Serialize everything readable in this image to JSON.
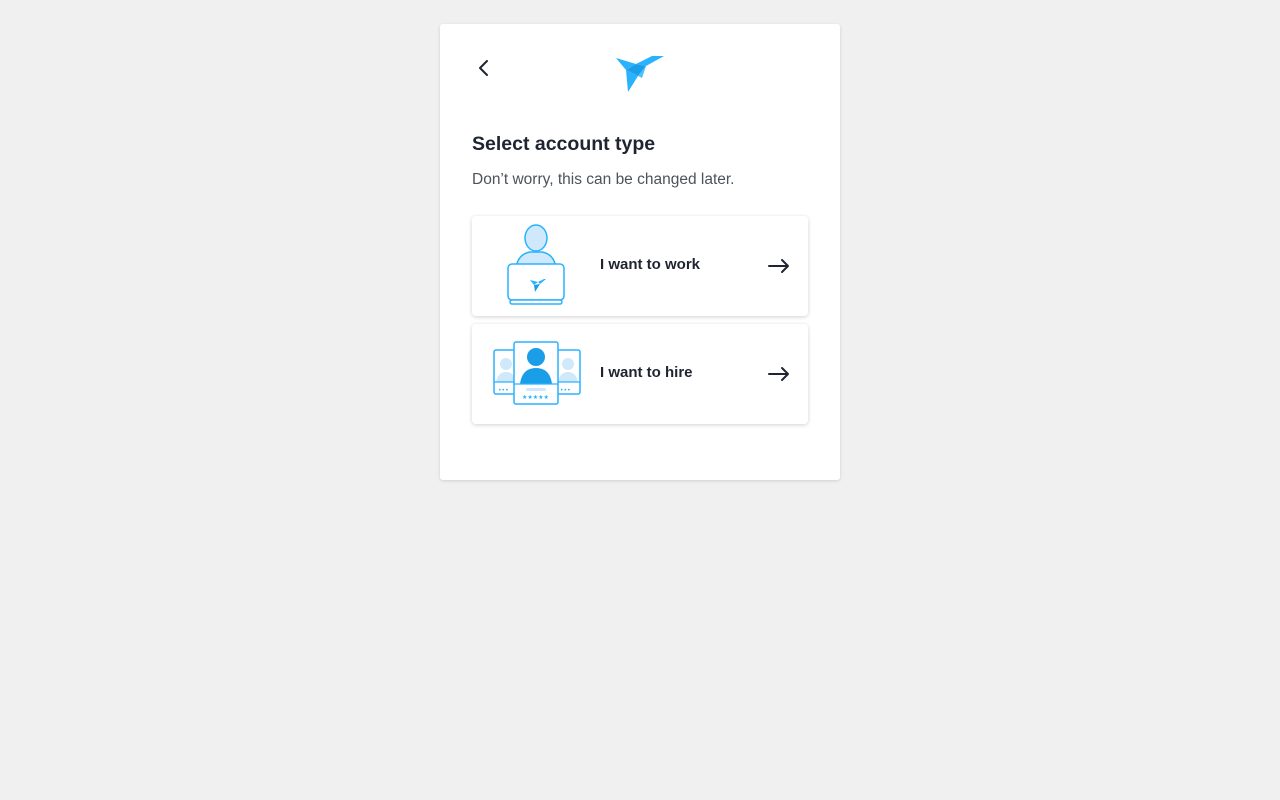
{
  "header": {
    "back_icon": "chevron-left-icon",
    "logo_icon": "bird-logo-icon"
  },
  "main": {
    "title": "Select account type",
    "subtitle": "Don’t worry, this can be changed later."
  },
  "options": [
    {
      "label": "I want to work",
      "illustration": "freelancer-laptop-icon",
      "arrow_icon": "arrow-right-icon"
    },
    {
      "label": "I want to hire",
      "illustration": "candidate-profiles-icon",
      "arrow_icon": "arrow-right-icon"
    }
  ],
  "colors": {
    "brand_blue": "#29b2fe",
    "light_blue": "#cfe9fb",
    "text_dark": "#1f2430",
    "text_muted": "#4d525b",
    "background": "#f0f0f0"
  }
}
